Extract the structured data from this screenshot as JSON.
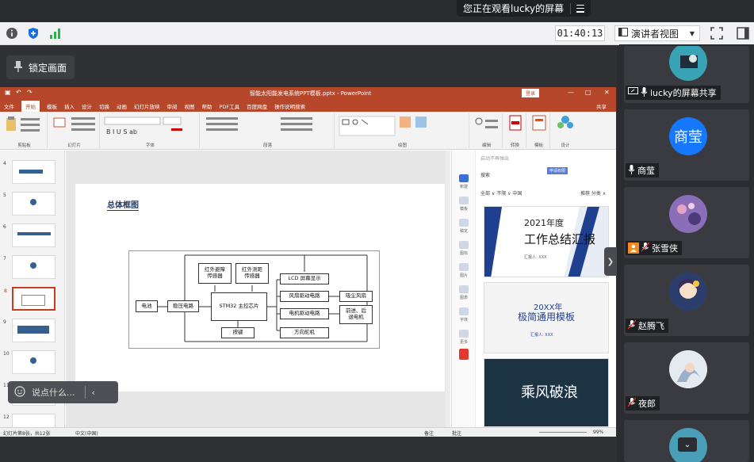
{
  "banner": {
    "viewing_text": "您正在观看lucky的屏幕"
  },
  "toolbar": {
    "timer": "01:40:13",
    "view_mode": "演讲者视图"
  },
  "share": {
    "lock_label": "锁定画面",
    "chat_placeholder": "说点什么..."
  },
  "ppt": {
    "file_title": "智能太阳能发电系统PPT模板.pptx  -  PowerPoint",
    "login": "登录",
    "tabs": [
      "文件",
      "开始",
      "模板",
      "插入",
      "设计",
      "切换",
      "动画",
      "幻灯片放映",
      "审阅",
      "视图",
      "帮助",
      "PDF工具",
      "百度网盘",
      "操作说明搜索"
    ],
    "share": "共享",
    "ribbon_groups": [
      "剪贴板",
      "幻灯片",
      "字体",
      "段落",
      "绘图",
      "编辑",
      "转换",
      "模板",
      "设计"
    ],
    "slide_numbers": [
      "4",
      "5",
      "6",
      "7",
      "8",
      "9",
      "10",
      "11",
      "12"
    ],
    "slide": {
      "title": "总体框图",
      "boxes": {
        "ir_sensor": "红外避障\n传感器",
        "ir_range": "红外测距\n传感器",
        "battery": "电池",
        "regulator": "稳压电路",
        "mcu": "STM32 主控芯片",
        "lcd": "LCD 屏幕显示",
        "fan_drive": "风扇驱动电路",
        "suction_fan": "吸尘风扇",
        "motor_drive": "电机驱动电路",
        "move": "前进、后\n退电机",
        "keys": "按键",
        "steering": "方向舵机"
      }
    },
    "status": {
      "slide_count": "幻灯片第8张，共12张",
      "lang": "中文(中国)",
      "notes": "备注",
      "comments": "批注",
      "zoom": "99%"
    },
    "template_pane": {
      "search_placeholder": "启动不再弹出",
      "search_label": "搜索",
      "filters": "全部 ∨  不限  ∨  中国",
      "sort": "推荐  分类 ∧",
      "side_items": [
        "新建",
        "模板",
        "稿定",
        "图标",
        "图片",
        "图表",
        "字体",
        "更多"
      ],
      "badge": "申请权限",
      "cards": [
        {
          "title": "2021年度",
          "subtitle": "工作总结汇报",
          "line": "汇报人: XXX"
        },
        {
          "title": "20XX年",
          "subtitle": "极简通用模板",
          "line": "汇报人: XXX"
        },
        {
          "title": "乘风破浪"
        }
      ]
    }
  },
  "participants": [
    {
      "name": "lucky的屏幕共享",
      "status": "sharing"
    },
    {
      "name": "商莹",
      "avatar_text": "商莹",
      "avatar_color": "#1677ff"
    },
    {
      "name": "张雪侠"
    },
    {
      "name": "赵腾飞"
    },
    {
      "name": "夜郎"
    }
  ]
}
